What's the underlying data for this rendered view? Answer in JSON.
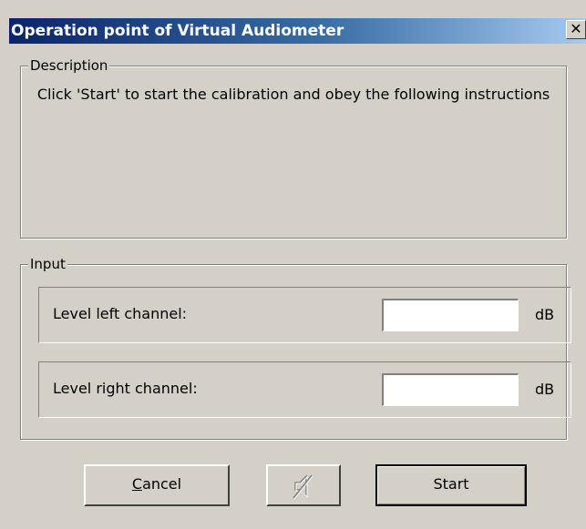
{
  "window": {
    "title": "Operation point of Virtual Audiometer",
    "close_glyph": "✕"
  },
  "description": {
    "group_label": "Description",
    "text": "Click 'Start' to start the calibration and obey the following instructions"
  },
  "input": {
    "group_label": "Input",
    "rows": [
      {
        "label": "Level left channel:",
        "value": "",
        "unit": "dB"
      },
      {
        "label": "Level right channel:",
        "value": "",
        "unit": "dB"
      }
    ]
  },
  "buttons": {
    "cancel_mnemonic": "C",
    "cancel_rest": "ancel",
    "mute_icon": "speaker-muted-icon",
    "start_label": "Start"
  },
  "colors": {
    "title_gradient_start": "#0a246a",
    "title_gradient_end": "#a6caf0",
    "face": "#d4d0c8"
  }
}
